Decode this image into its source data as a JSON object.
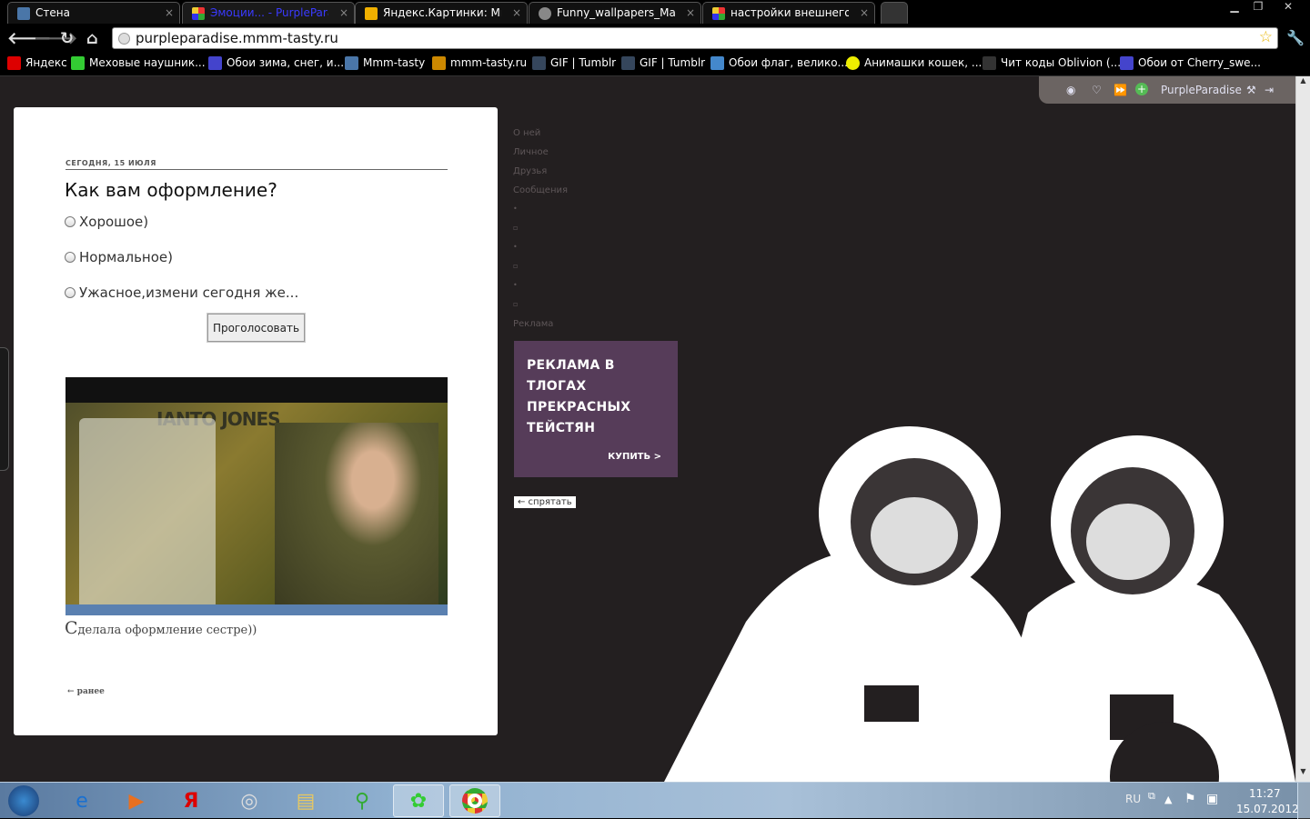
{
  "browser": {
    "tabs": [
      {
        "label": "Стена",
        "icon": "vk-icon",
        "color": "#4a76a8",
        "active": false
      },
      {
        "label": "Эмоции... - PurpleParadise",
        "icon": "mmm-tasty-icon",
        "color": "#2a2aff",
        "active": true
      },
      {
        "label": "Яндекс.Картинки: Миним",
        "icon": "yandex-images-icon",
        "color": "#f0b000",
        "active": false
      },
      {
        "label": "Funny_wallpapers_Males_a",
        "icon": "globe-icon",
        "color": "#888888",
        "active": false
      },
      {
        "label": "настройки внешнего вида",
        "icon": "mmm-tasty-icon",
        "color": "#2a2aff",
        "active": false
      }
    ],
    "url": "purpleparadise.mmm-tasty.ru",
    "bookmarks": [
      {
        "label": "Яндекс",
        "icon": "yandex-icon",
        "color": "#d00"
      },
      {
        "label": "Меховые наушник...",
        "icon": "arrow-icon",
        "color": "#3c3"
      },
      {
        "label": "Обои зима, снег, и...",
        "icon": "gif-icon",
        "color": "#44c"
      },
      {
        "label": "Mmm-tasty",
        "icon": "vk-icon",
        "color": "#4a76a8"
      },
      {
        "label": "mmm-tasty.ru",
        "icon": "mmm-tasty-icon",
        "color": "#c80"
      },
      {
        "label": "GIF | Tumblr",
        "icon": "tumblr-icon",
        "color": "#35465c"
      },
      {
        "label": "GIF | Tumblr",
        "icon": "tumblr-icon",
        "color": "#35465c"
      },
      {
        "label": "Обои флаг, велико...",
        "icon": "calendar-icon",
        "color": "#48c"
      },
      {
        "label": "Анимашки кошек, ...",
        "icon": "smiley-icon",
        "color": "#ee0"
      },
      {
        "label": "Чит коды Oblivion (...",
        "icon": "fg-icon",
        "color": "#333"
      },
      {
        "label": "Обои от Cherry_swe...",
        "icon": "gif-icon",
        "color": "#44c"
      }
    ]
  },
  "toolbar": {
    "username": "PurpleParadise"
  },
  "post": {
    "date": "СЕГОДНЯ, 15 ИЮЛЯ",
    "question": "Как вам оформление?",
    "options": [
      "Хорошое)",
      "Нормальное)",
      "Ужасное,измени сегодня же..."
    ],
    "vote_label": "Проголосовать",
    "caption_first": "С",
    "caption_rest": "делала оформление сестре))",
    "screenshot_title": "IANTO JONES",
    "earlier_label": "← ранее"
  },
  "menu": {
    "items": [
      "О ней",
      "Личное",
      "Друзья",
      "Сообщения",
      "•",
      "▫",
      "•",
      "▫",
      "•",
      "▫",
      "Реклама"
    ]
  },
  "ad": {
    "headline": "РЕКЛАМА В ТЛОГАХ ПРЕКРАСНЫХ ТЕЙСТЯН",
    "buy": "КУПИТЬ >",
    "hide": "← спрятать",
    "bg": "#563c59"
  },
  "taskbar": {
    "lang": "RU",
    "time": "11:27",
    "date": "15.07.2012"
  }
}
